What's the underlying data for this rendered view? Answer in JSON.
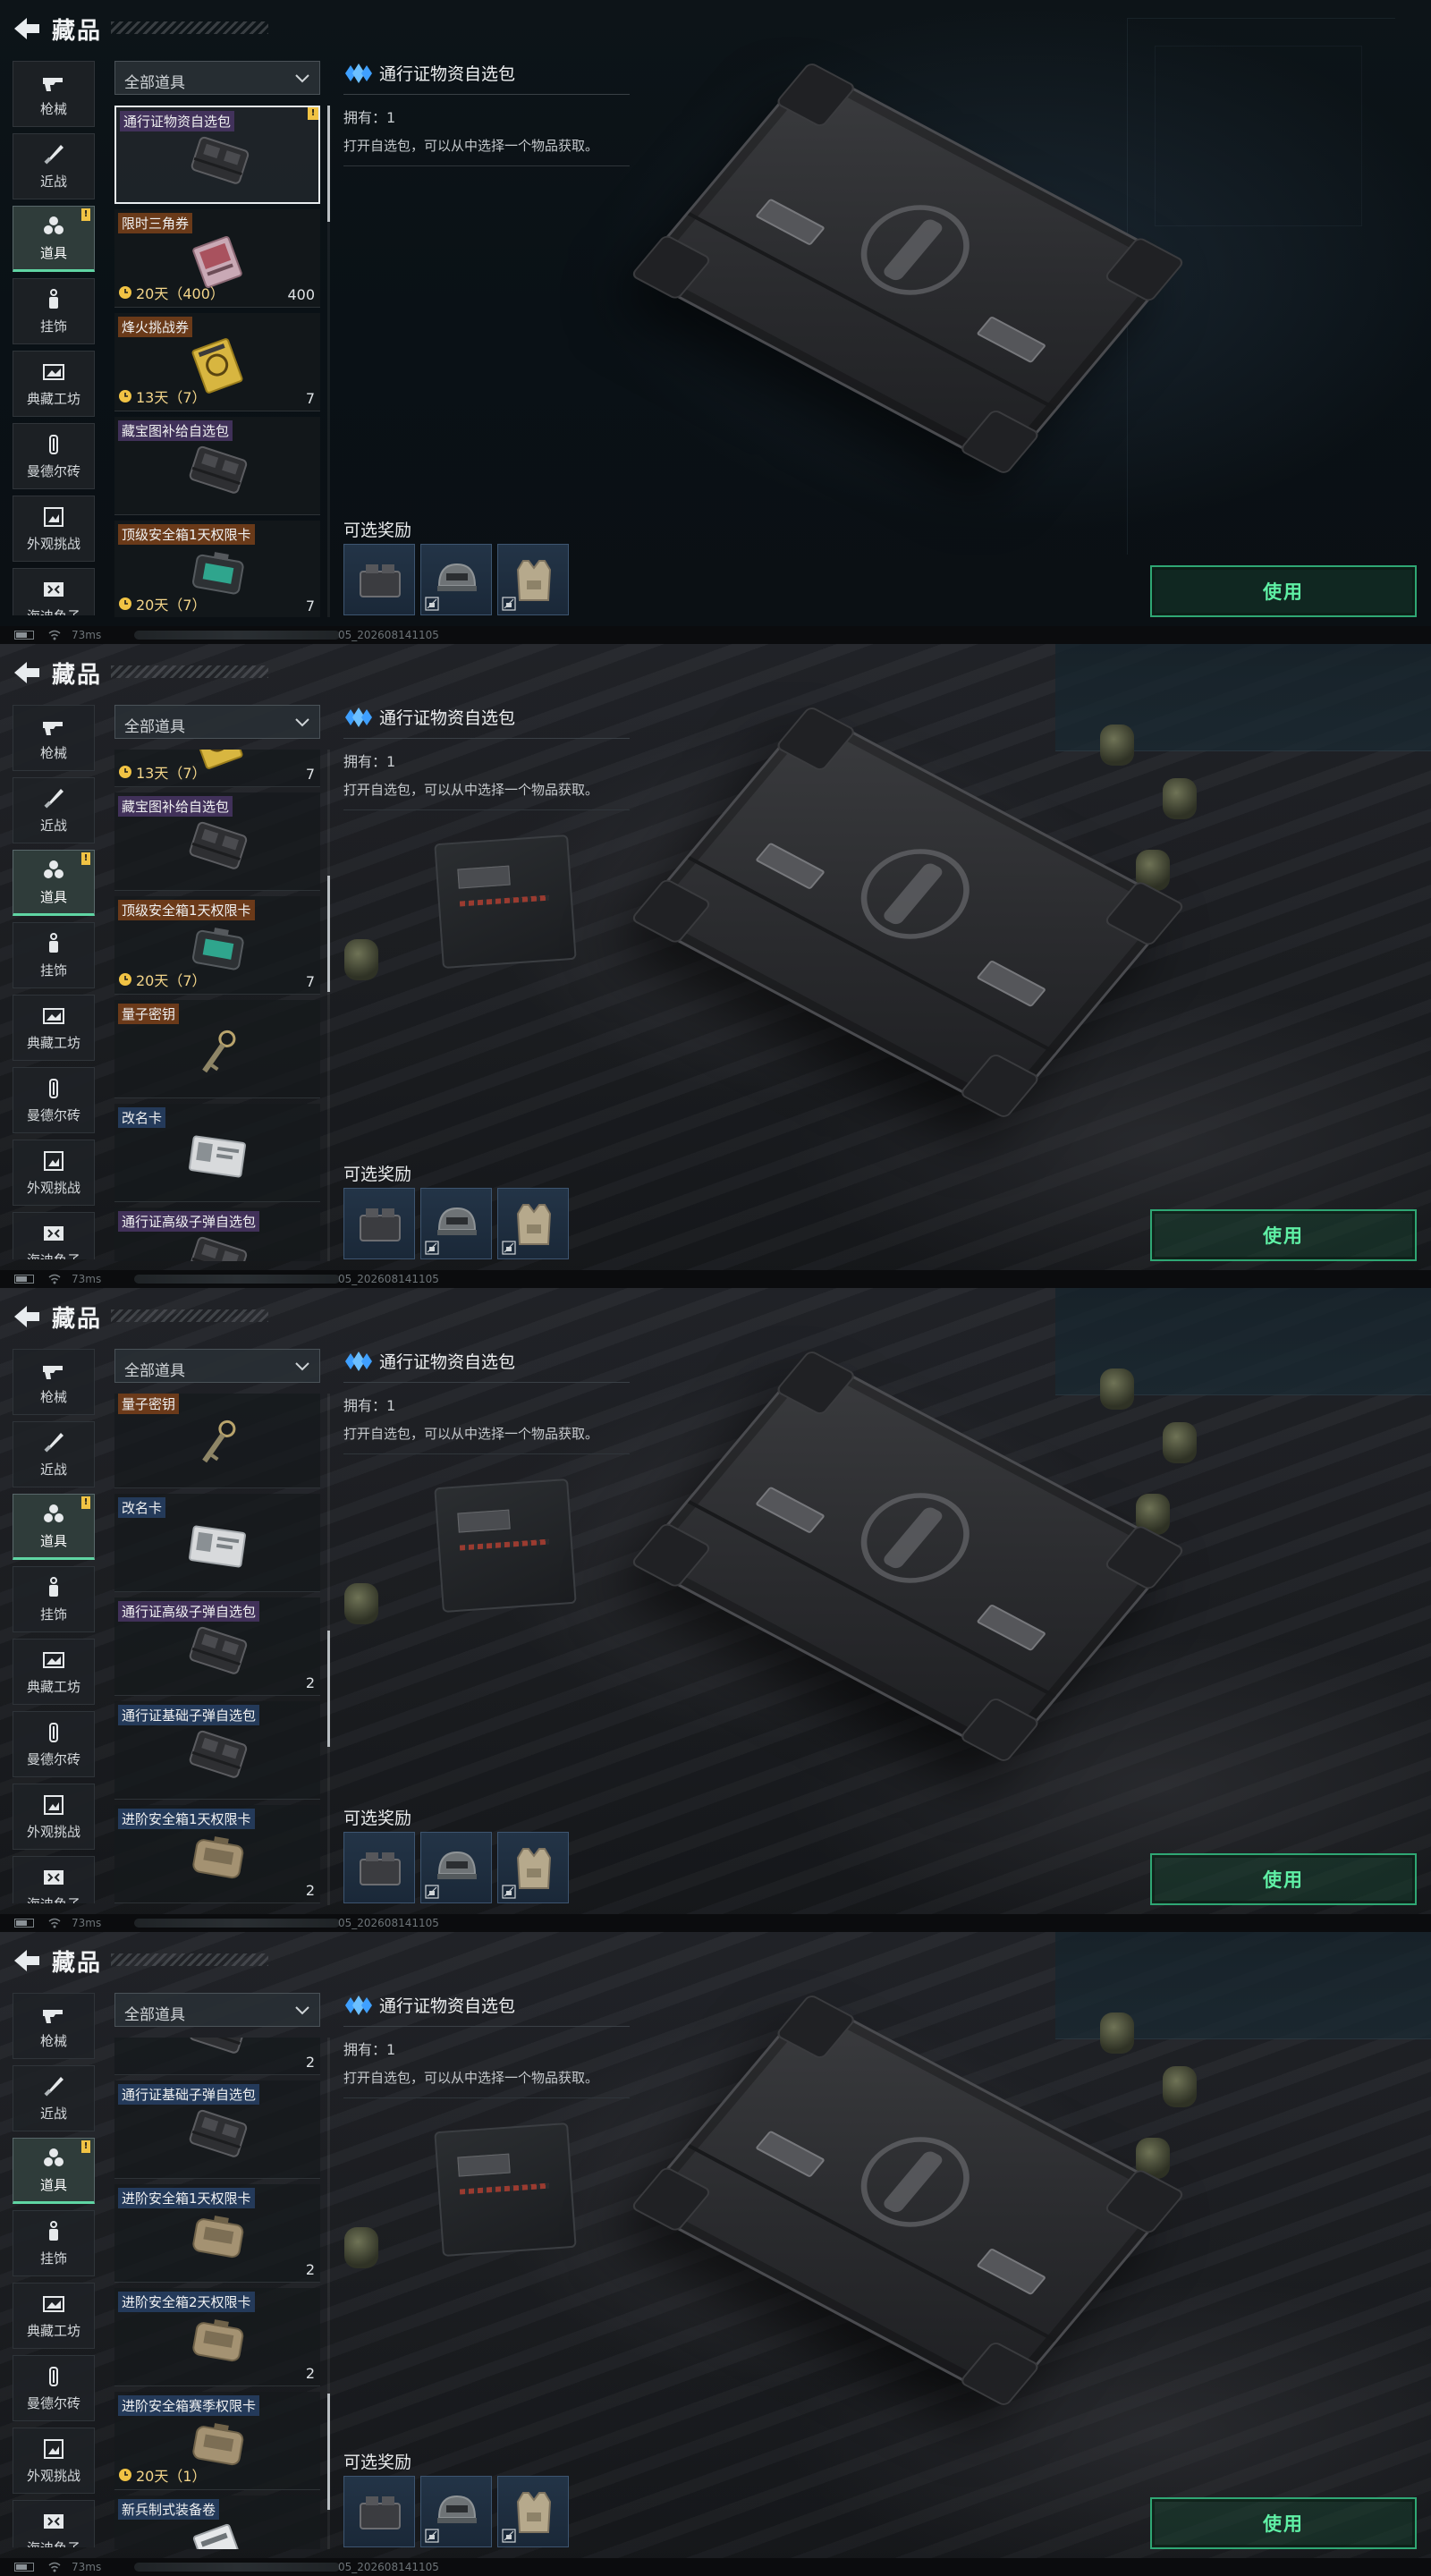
{
  "page": {
    "title": "藏品"
  },
  "filter": {
    "label": "全部道具"
  },
  "categories": [
    {
      "label": "枪械",
      "icon": "gun-icon",
      "active": false,
      "badge": ""
    },
    {
      "label": "近战",
      "icon": "knife-icon",
      "active": false,
      "badge": ""
    },
    {
      "label": "道具",
      "icon": "props-icon",
      "active": true,
      "badge": "!"
    },
    {
      "label": "挂饰",
      "icon": "charm-icon",
      "active": false,
      "badge": ""
    },
    {
      "label": "典藏工坊",
      "icon": "workshop-icon",
      "active": false,
      "badge": ""
    },
    {
      "label": "曼德尔砖",
      "icon": "brick-icon",
      "active": false,
      "badge": ""
    },
    {
      "label": "外观挑战",
      "icon": "challenge-icon",
      "active": false,
      "badge": ""
    },
    {
      "label": "海迪鱼子",
      "icon": "hive-icon",
      "active": false,
      "badge": ""
    }
  ],
  "items": [
    {
      "name": "通行证物资自选包",
      "thumb": "box-crate-icon",
      "rarity": "purple",
      "timer": "",
      "qty": "",
      "new": "!",
      "selected": true
    },
    {
      "name": "限时三角券",
      "thumb": "ticket-pink-icon",
      "rarity": "orange",
      "timer": "20天（400）",
      "qty": "400",
      "new": "",
      "selected": false
    },
    {
      "name": "烽火挑战券",
      "thumb": "ticket-gold-icon",
      "rarity": "orange",
      "timer": "13天（7）",
      "qty": "7",
      "new": "",
      "selected": false
    },
    {
      "name": "藏宝图补给自选包",
      "thumb": "box-crate-icon",
      "rarity": "purple",
      "timer": "",
      "qty": "",
      "new": "",
      "selected": false
    },
    {
      "name": "顶级安全箱1天权限卡",
      "thumb": "case-teal-icon",
      "rarity": "orange",
      "timer": "20天（7）",
      "qty": "7",
      "new": "",
      "selected": false
    },
    {
      "name": "量子密钥",
      "thumb": "key-icon",
      "rarity": "orange",
      "timer": "",
      "qty": "",
      "new": "",
      "selected": false
    },
    {
      "name": "改名卡",
      "thumb": "id-card-icon",
      "rarity": "blue",
      "timer": "",
      "qty": "",
      "new": "",
      "selected": false
    },
    {
      "name": "通行证高级子弹自选包",
      "thumb": "box-crate-icon",
      "rarity": "purple",
      "timer": "",
      "qty": "2",
      "new": "",
      "selected": false
    },
    {
      "name": "通行证基础子弹自选包",
      "thumb": "box-crate-icon",
      "rarity": "blue",
      "timer": "",
      "qty": "",
      "new": "",
      "selected": false
    },
    {
      "name": "进阶安全箱1天权限卡",
      "thumb": "case-tan-icon",
      "rarity": "blue",
      "timer": "",
      "qty": "2",
      "new": "",
      "selected": false
    },
    {
      "name": "进阶安全箱2天权限卡",
      "thumb": "case-tan-icon",
      "rarity": "blue",
      "timer": "",
      "qty": "2",
      "new": "",
      "selected": false
    },
    {
      "name": "进阶安全箱赛季权限卡",
      "thumb": "case-tan-icon",
      "rarity": "blue",
      "timer": "20天（1）",
      "qty": "",
      "new": "",
      "selected": false
    },
    {
      "name": "新兵制式装备卷",
      "thumb": "ticket-white-icon",
      "rarity": "blue",
      "timer": "",
      "qty": "",
      "new": "",
      "selected": false
    }
  ],
  "detail": {
    "title": "通行证物资自选包",
    "owned": "拥有：1",
    "description": "打开自选包，可以从中选择一个物品获取。",
    "rewards_title": "可选奖励",
    "rewards": [
      {
        "icon": "ammo-box-icon",
        "locked": false
      },
      {
        "icon": "helmet-icon",
        "locked": true
      },
      {
        "icon": "armor-vest-icon",
        "locked": true
      }
    ]
  },
  "use_button": {
    "label": "使用"
  },
  "statusbar": {
    "ping": "73ms",
    "build": "05_202608141105"
  },
  "frames": [
    {
      "background": "dark",
      "list_offset": 0,
      "scroll": 0.0
    },
    {
      "background": "cloth",
      "list_offset": 2.55,
      "scroll": 0.32
    },
    {
      "background": "cloth",
      "list_offset": 5.0,
      "scroll": 0.6
    },
    {
      "background": "cloth",
      "list_offset": 7.55,
      "scroll": 0.9
    }
  ],
  "colors": {
    "accent": "#5ff0a5",
    "active_tab": "#5fd5a3",
    "badge": "#f1c344",
    "timer": "#f3d58a"
  }
}
